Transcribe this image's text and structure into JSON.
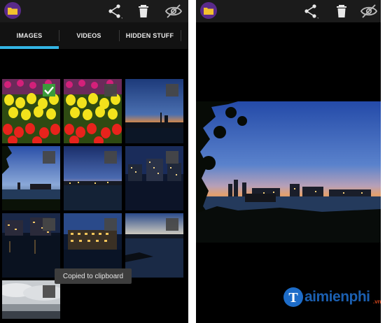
{
  "left_screen": {
    "tabs": [
      {
        "label": "IMAGES",
        "active": true
      },
      {
        "label": "VIDEOS",
        "active": false
      },
      {
        "label": "HIDDEN STUFF",
        "active": false
      }
    ],
    "toast": "Copied to clipboard",
    "thumbnails": [
      {
        "subject": "tulips",
        "selected": true
      },
      {
        "subject": "tulips",
        "selected": false
      },
      {
        "subject": "dusk harbour",
        "selected": false
      },
      {
        "subject": "harbour skyline",
        "selected": false
      },
      {
        "subject": "harbour at dusk",
        "selected": false
      },
      {
        "subject": "night city lights",
        "selected": false
      },
      {
        "subject": "night waterfront",
        "selected": false
      },
      {
        "subject": "lit building",
        "selected": false
      },
      {
        "subject": "sunset river",
        "selected": false
      },
      {
        "subject": "cloudy sky",
        "selected": false
      }
    ]
  },
  "actionbar": {
    "icons": [
      "folder-icon",
      "share-icon",
      "delete-icon",
      "hide-icon"
    ]
  },
  "watermark": {
    "logo_letter": "T",
    "text": "aimienphi",
    "suffix": ".vn"
  },
  "colors": {
    "accent": "#33b5e5",
    "actionbar_bg": "#1b1b1b",
    "badge": "#5a2a8a",
    "check_green": "#3b9b3b"
  }
}
